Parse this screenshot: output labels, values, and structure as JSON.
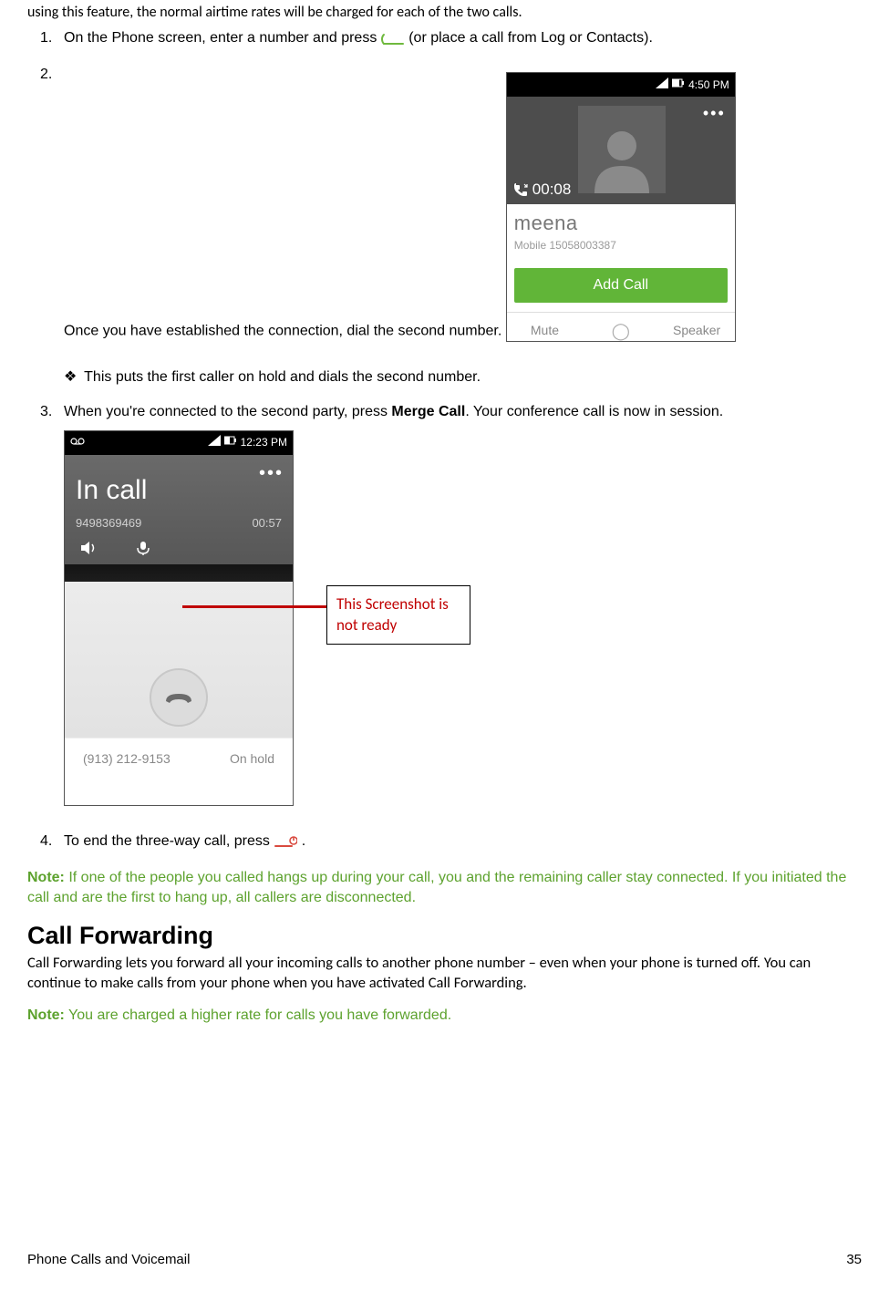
{
  "intro": "using this feature, the normal airtime rates will be charged for each of the two calls.",
  "steps": {
    "s1_pre": "On the Phone screen, enter a number and press ",
    "s1_post": " (or place a call from Log or Contacts).",
    "s2": "Once you have established the connection, dial the second number.",
    "bullet": "This puts the first caller on hold and dials the second number.",
    "s3_pre": "When you're connected to the second party, press ",
    "s3_bold": "Merge Call",
    "s3_post": ". Your conference call is now in session.",
    "s4_pre": "To end the three-way call, press ",
    "s4_post": "."
  },
  "shot1": {
    "time": "4:50 PM",
    "duration": "00:08",
    "name": "meena",
    "sub": "Mobile 15058003387",
    "addcall": "Add Call",
    "mute": "Mute",
    "speaker": "Speaker"
  },
  "shot2": {
    "time": "12:23 PM",
    "title": "In call",
    "number": "9498369469",
    "duration": "00:57",
    "holdnum": "(913) 212-9153",
    "holdlabel": "On hold"
  },
  "annotation": "This Screenshot is not ready",
  "note1": "If one of the people you called hangs up during your call, you and the remaining caller stay connected. If you initiated the call and are the first to hang up, all callers are disconnected.",
  "note_label": "Note:",
  "cf_heading": "Call Forwarding",
  "cf_para": "Call Forwarding lets you forward all your incoming calls to another phone number – even when your phone is turned off. You can continue to make calls from your phone when you have activated Call Forwarding.",
  "note2": "You are charged a higher rate for calls you have forwarded.",
  "footer_left": "Phone Calls and Voicemail",
  "footer_right": "35"
}
